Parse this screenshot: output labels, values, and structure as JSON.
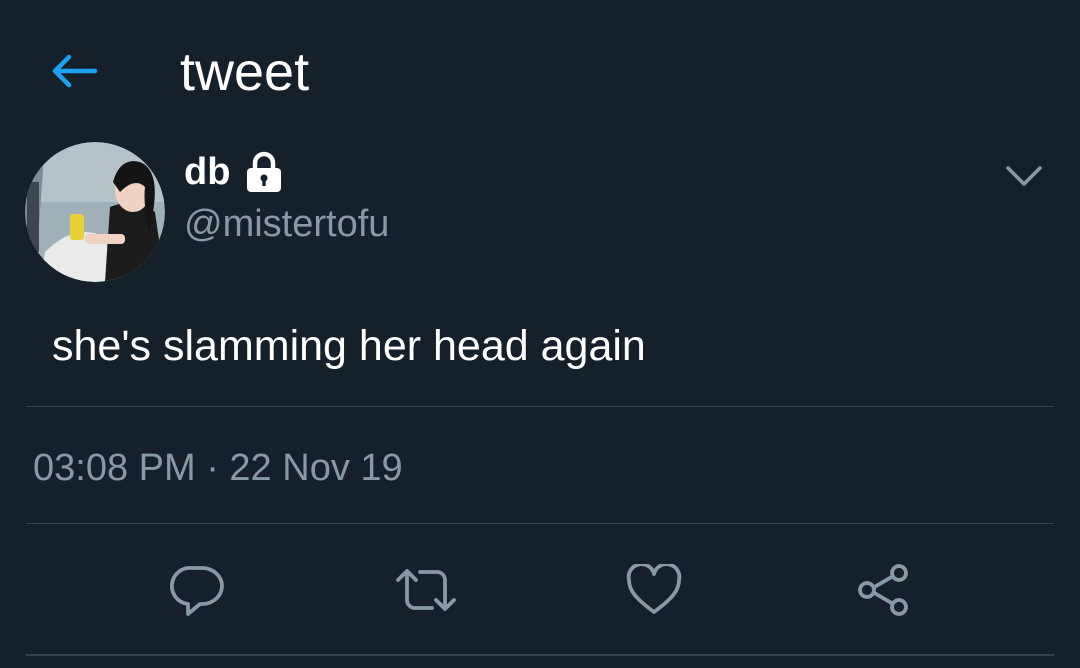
{
  "header": {
    "title": "tweet",
    "back_icon": "arrow-left-icon"
  },
  "tweet": {
    "display_name": "db",
    "protected_icon": "lock-icon",
    "handle": "@mistertofu",
    "text": "she's slamming her head again",
    "timestamp": "03:08 PM · 22 Nov 19",
    "menu_icon": "chevron-down-icon"
  },
  "actions": [
    {
      "name": "reply",
      "icon": "reply-icon"
    },
    {
      "name": "retweet",
      "icon": "retweet-icon"
    },
    {
      "name": "like",
      "icon": "heart-icon"
    },
    {
      "name": "share",
      "icon": "share-icon"
    }
  ],
  "colors": {
    "background": "#15202b",
    "accent": "#1da1f2",
    "secondary_text": "#8899a6",
    "divider": "#38444d"
  }
}
